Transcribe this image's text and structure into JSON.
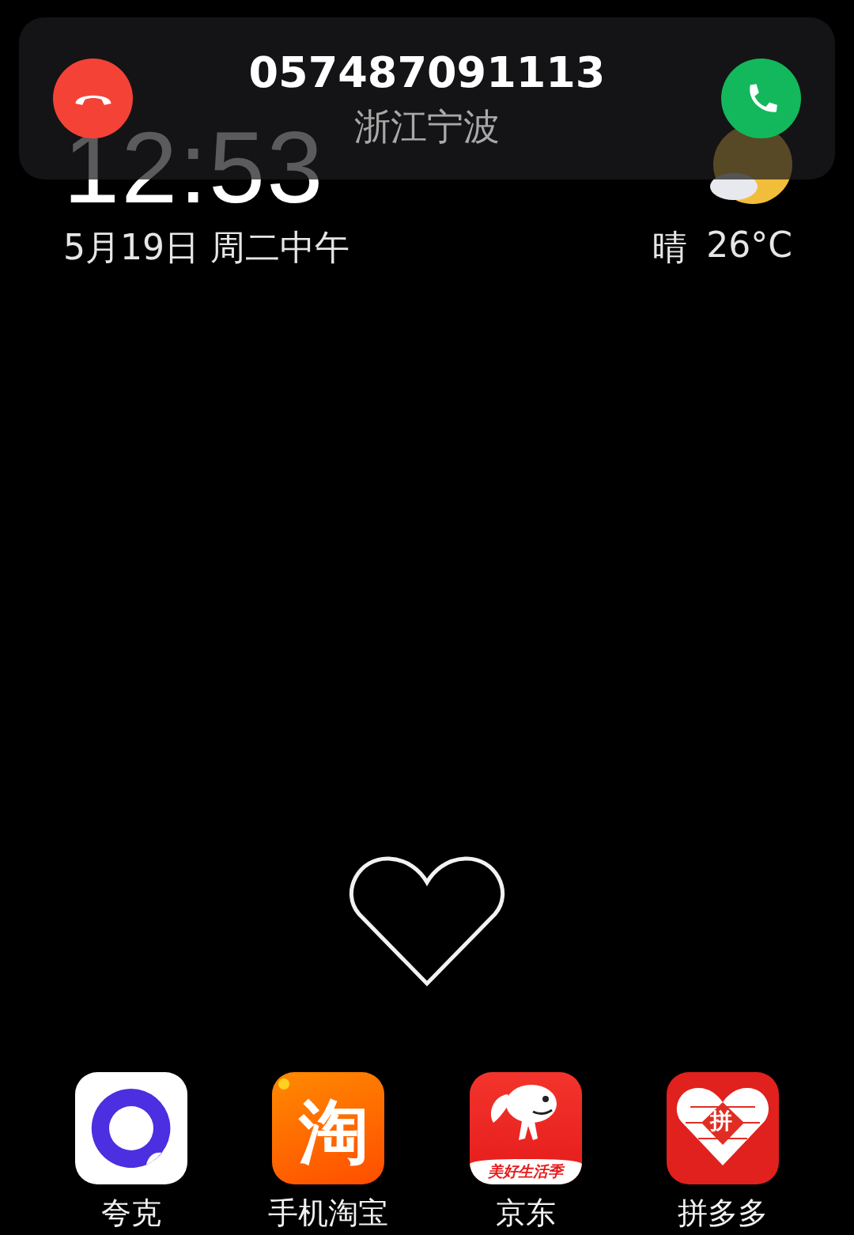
{
  "incoming_call": {
    "number": "057487091113",
    "location": "浙江宁波",
    "buttons": [
      {
        "kind": "decline"
      },
      {
        "kind": "answer"
      }
    ]
  },
  "clock_widget": {
    "time": "12:53",
    "date": "5月19日 周二中午",
    "weather": "晴",
    "temperature": "26°C"
  },
  "dock": [
    {
      "kind": "quark",
      "label": "夸克"
    },
    {
      "kind": "taobao",
      "label": "手机淘宝",
      "logo_text": "淘"
    },
    {
      "kind": "jd",
      "label": "京东",
      "logo_text": "美好生活季"
    },
    {
      "kind": "pdd",
      "label": "拼多多",
      "logo_text": "拼"
    }
  ]
}
